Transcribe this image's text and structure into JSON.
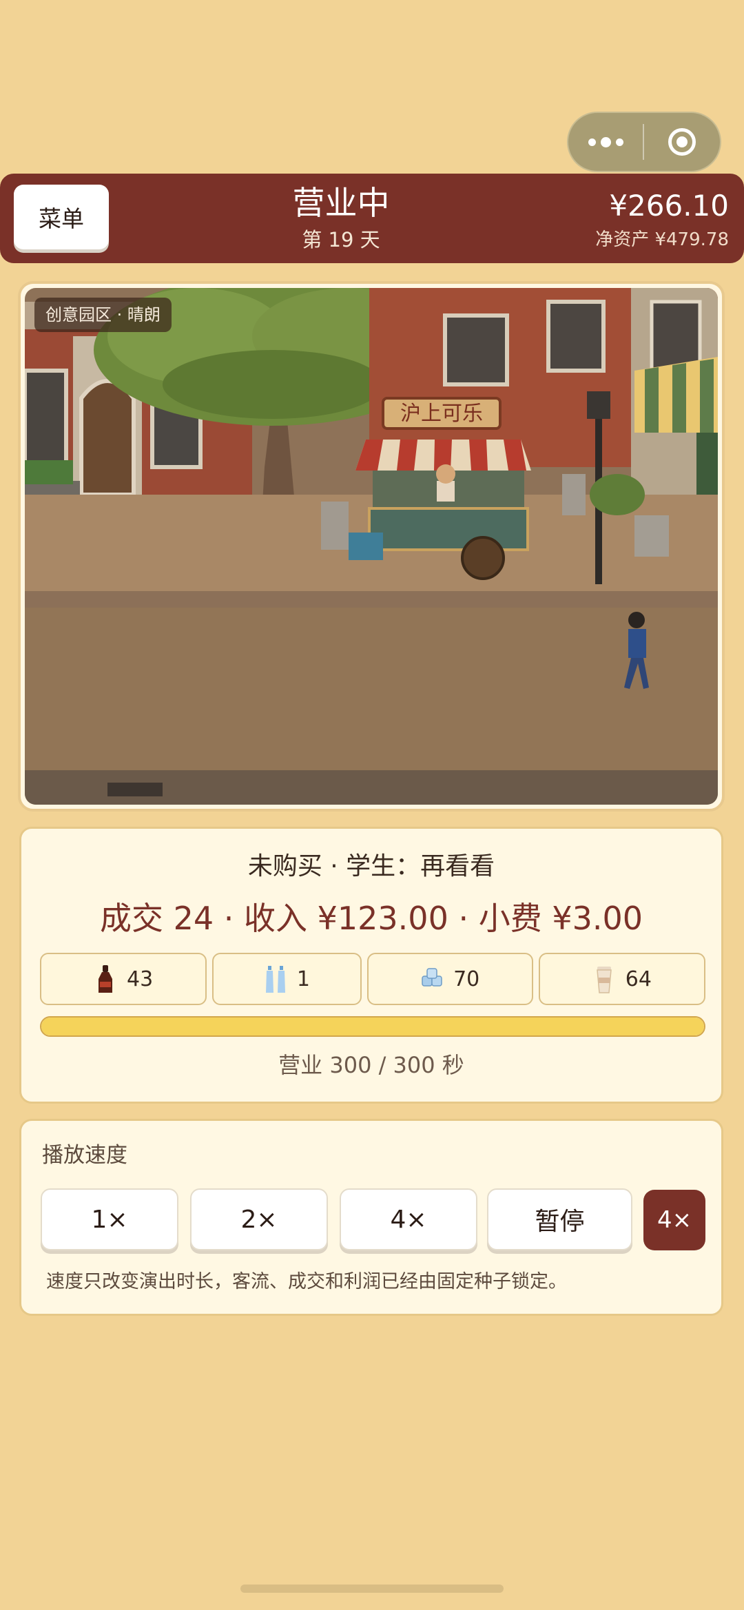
{
  "capsule": {
    "more_icon": "more-dots-icon",
    "close_icon": "target-circle-icon"
  },
  "header": {
    "menu_label": "菜单",
    "status": "营业中",
    "day": "第 19 天",
    "cash": "¥266.10",
    "net_assets": "净资产 ¥479.78"
  },
  "scene": {
    "location_tag": "创意园区 · 晴朗",
    "stall_sign": "沪上可乐"
  },
  "stats": {
    "customer_status": "未购买 · 学生：再看看",
    "summary": "成交 24 · 收入 ¥123.00 · 小费 ¥3.00",
    "inventory": [
      {
        "icon": "cola-bottle-icon",
        "count": "43"
      },
      {
        "icon": "water-bottles-icon",
        "count": "1"
      },
      {
        "icon": "ice-cubes-icon",
        "count": "70"
      },
      {
        "icon": "paper-cup-icon",
        "count": "64"
      }
    ],
    "progress_fraction": 1.0,
    "progress_text": "营业 300 / 300 秒"
  },
  "speed": {
    "title": "播放速度",
    "options": [
      "1×",
      "2×",
      "4×",
      "暂停"
    ],
    "current": "4×",
    "note": "速度只改变演出时长，客流、成交和利润已经由固定种子锁定。"
  },
  "colors": {
    "background": "#F2D395",
    "header": "#7A3128",
    "accent_text": "#7A3128",
    "progress": "#F5D35A"
  }
}
